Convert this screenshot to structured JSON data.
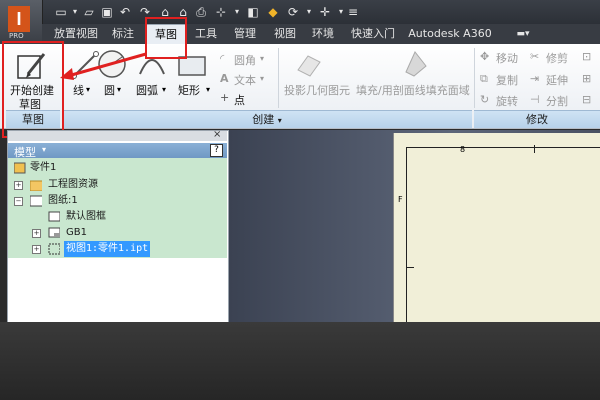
{
  "app": {
    "logo_letter": "I",
    "edition": "PRO"
  },
  "tabs": [
    "放置视图",
    "标注",
    "草图",
    "工具",
    "管理",
    "视图",
    "环境",
    "快速入门",
    "Autodesk A360"
  ],
  "active_tab_index": 2,
  "ribbon": {
    "create_sketch": {
      "line1": "开始创建",
      "line2": "草图"
    },
    "tools": {
      "line": "线",
      "circle": "圆",
      "arc": "圆弧",
      "rect": "矩形"
    },
    "small": {
      "fillet": "圆角",
      "text": "文本",
      "point": "点"
    },
    "disabled": {
      "project": "投影几何图元",
      "fill": "填充/用剖面线填充面域"
    },
    "modify": {
      "move": "移动",
      "trim": "修剪",
      "copy": "复制",
      "extend": "延伸",
      "rotate": "旋转",
      "split": "分割"
    },
    "panels": {
      "sketch": "草图",
      "create": "创建",
      "modify": "修改"
    }
  },
  "browser": {
    "title": "模型",
    "help_glyph": "?",
    "tree": [
      {
        "label": "零件1",
        "level": 0
      },
      {
        "label": "工程图资源",
        "level": 1
      },
      {
        "label": "图纸:1",
        "level": 1
      },
      {
        "label": "默认图框",
        "level": 2
      },
      {
        "label": "GB1",
        "level": 2
      },
      {
        "label": "视图1:零件1.ipt",
        "level": 2
      }
    ]
  },
  "drawing": {
    "top_mark": "8",
    "side_mark": "F"
  },
  "colors": {
    "annotation_red": "#e02020",
    "selection_blue": "#3399ff"
  }
}
